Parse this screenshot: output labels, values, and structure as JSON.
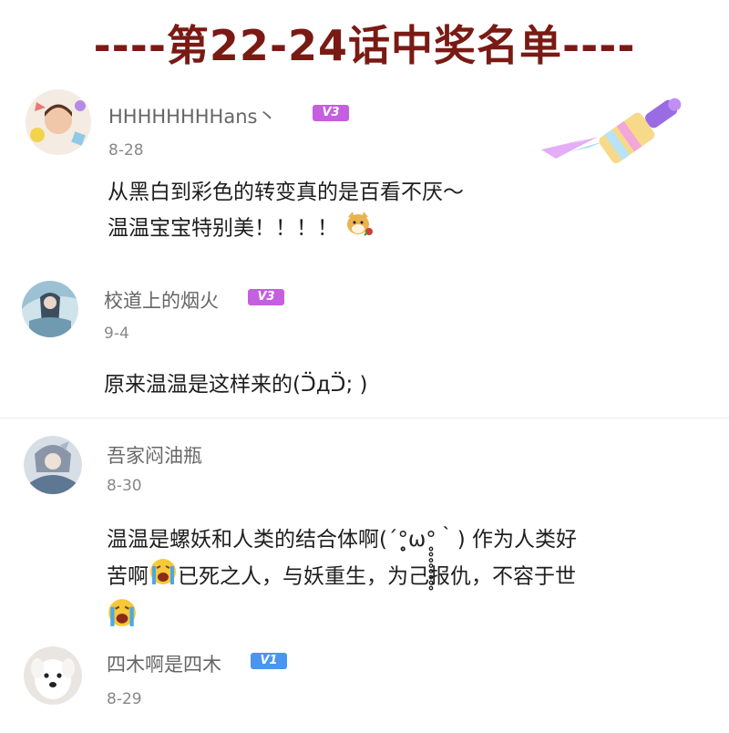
{
  "banner": {
    "title": "----第22-24话中奖名单----"
  },
  "comments": [
    {
      "user": "HHHHHHHHans丶",
      "level": "V3",
      "date": "8-28",
      "lines": [
        "从黑白到彩色的转变真的是百看不厌～",
        "温温宝宝特别美！！！！"
      ],
      "emoji": "doge-rose-icon",
      "decoration": "paint-brush-pendant-icon"
    },
    {
      "user": "校道上的烟火",
      "level": "V3",
      "date": "9-4",
      "lines": [
        "原来温温是这样来的(ᑒдᑒ; )"
      ]
    },
    {
      "user": "吾家闷油瓶",
      "level": "",
      "date": "8-30",
      "lines": [
        "温温是螺妖和人类的结合体啊(´°̥̥̥̥̥̥̥̥ω°̥̥̥̥̥̥̥̥｀) 作为人类好",
        "苦啊",
        "已死之人，与妖重生，为己报仇，不容于世"
      ],
      "emoji": "crying-face-icon"
    },
    {
      "user": "四木啊是四木",
      "level": "V1",
      "date": "8-29"
    }
  ],
  "colors": {
    "banner": "#7a1a14",
    "v3": "#c55fe0",
    "v1": "#4b95f0"
  }
}
